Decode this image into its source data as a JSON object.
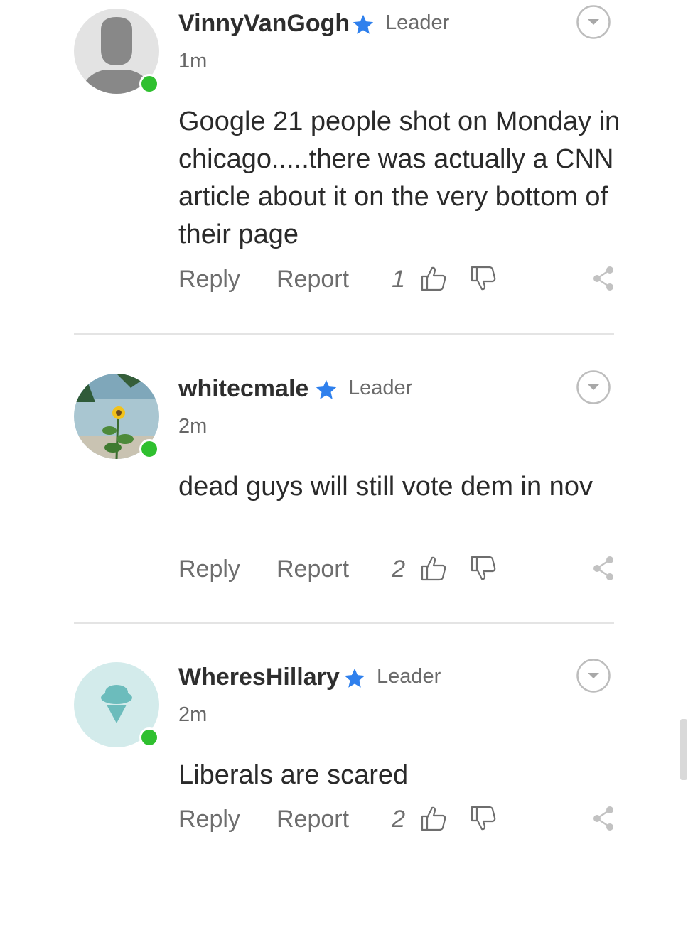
{
  "comments": [
    {
      "username": "VinnyVanGogh",
      "rank": "Leader",
      "time": "1m",
      "text": "Google 21 people shot on Monday in chicago.....there was actually a CNN article about it on the very bottom of their page",
      "reply_label": "Reply",
      "report_label": "Report",
      "votes": "1",
      "avatar": "default-silhouette-avatar"
    },
    {
      "username": "whitecmale",
      "rank": "Leader",
      "time": "2m",
      "text": "dead guys will still vote dem in nov",
      "reply_label": "Reply",
      "report_label": "Report",
      "votes": "2",
      "avatar": "sunflower-photo-avatar"
    },
    {
      "username": "WheresHillary",
      "rank": "Leader",
      "time": "2m",
      "text": "Liberals are scared",
      "reply_label": "Reply",
      "report_label": "Report",
      "votes": "2",
      "avatar": "ice-cream-cone-avatar"
    }
  ],
  "colors": {
    "star": "#2f80ed",
    "online": "#2fc02f",
    "muted_text": "#6e6e6e",
    "divider": "#e4e4e4"
  }
}
